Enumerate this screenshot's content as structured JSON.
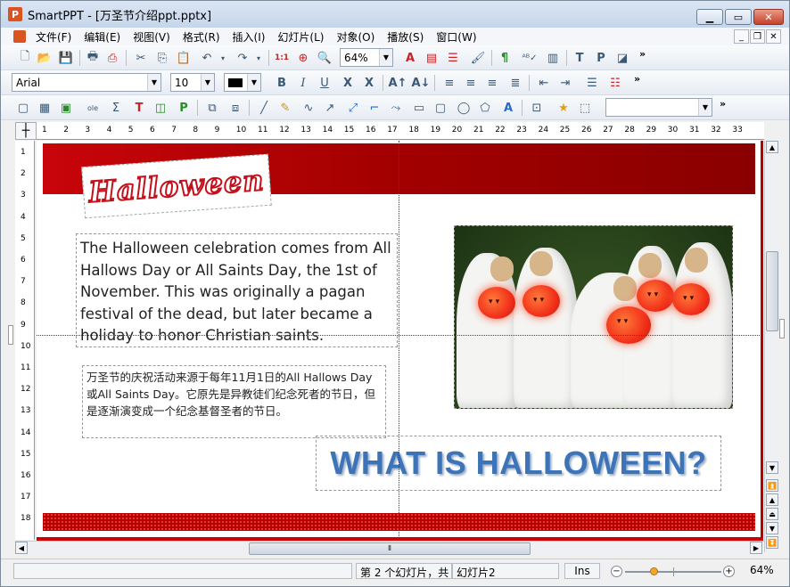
{
  "window": {
    "title": "SmartPPT - [万圣节介绍ppt.pptx]",
    "app_icon": "P"
  },
  "menu": [
    "文件(F)",
    "编辑(E)",
    "视图(V)",
    "格式(R)",
    "插入(I)",
    "幻灯片(L)",
    "对象(O)",
    "播放(S)",
    "窗口(W)"
  ],
  "toolbar1": {
    "zoom_value": "64%"
  },
  "toolbar2": {
    "font_name": "Arial",
    "font_size": "10",
    "bold": "B",
    "italic": "I",
    "underline": "U",
    "strike": "X",
    "x2": "X"
  },
  "ruler": {
    "h_ticks": [
      "1",
      "2",
      "3",
      "4",
      "5",
      "6",
      "7",
      "8",
      "9",
      "10",
      "11",
      "12",
      "13",
      "14",
      "15",
      "16",
      "17",
      "18",
      "19",
      "20",
      "21",
      "22",
      "23",
      "24",
      "25",
      "26",
      "27",
      "28",
      "29",
      "30",
      "31",
      "32",
      "33"
    ],
    "v_ticks": [
      "1",
      "2",
      "3",
      "4",
      "5",
      "6",
      "7",
      "8",
      "9",
      "10",
      "11",
      "12",
      "13",
      "14",
      "15",
      "16",
      "17",
      "18"
    ]
  },
  "slide": {
    "logo_text": "Halloween",
    "english_text": "The Halloween celebration comes from All Hallows Day or All Saints Day, the 1st of November. This was originally a pagan festival of the dead, but later became a holiday to honor Christian saints.",
    "chinese_text": "万圣节的庆祝活动来源于每年11月1日的All Hallows Day 或All Saints Day。它原先是异教徒们纪念死者的节日，但是逐渐演变成一个纪念基督圣者的节日。",
    "headline": "WHAT IS HALLOWEEN?"
  },
  "status": {
    "slide_pos": "第 2 个幻灯片，共",
    "slide_name": "幻灯片2",
    "mode": "Ins",
    "zoom": "64%",
    "zoom_level": 0.3
  },
  "colors": {
    "banner": "#c8050a",
    "headline": "#3d74b8"
  }
}
